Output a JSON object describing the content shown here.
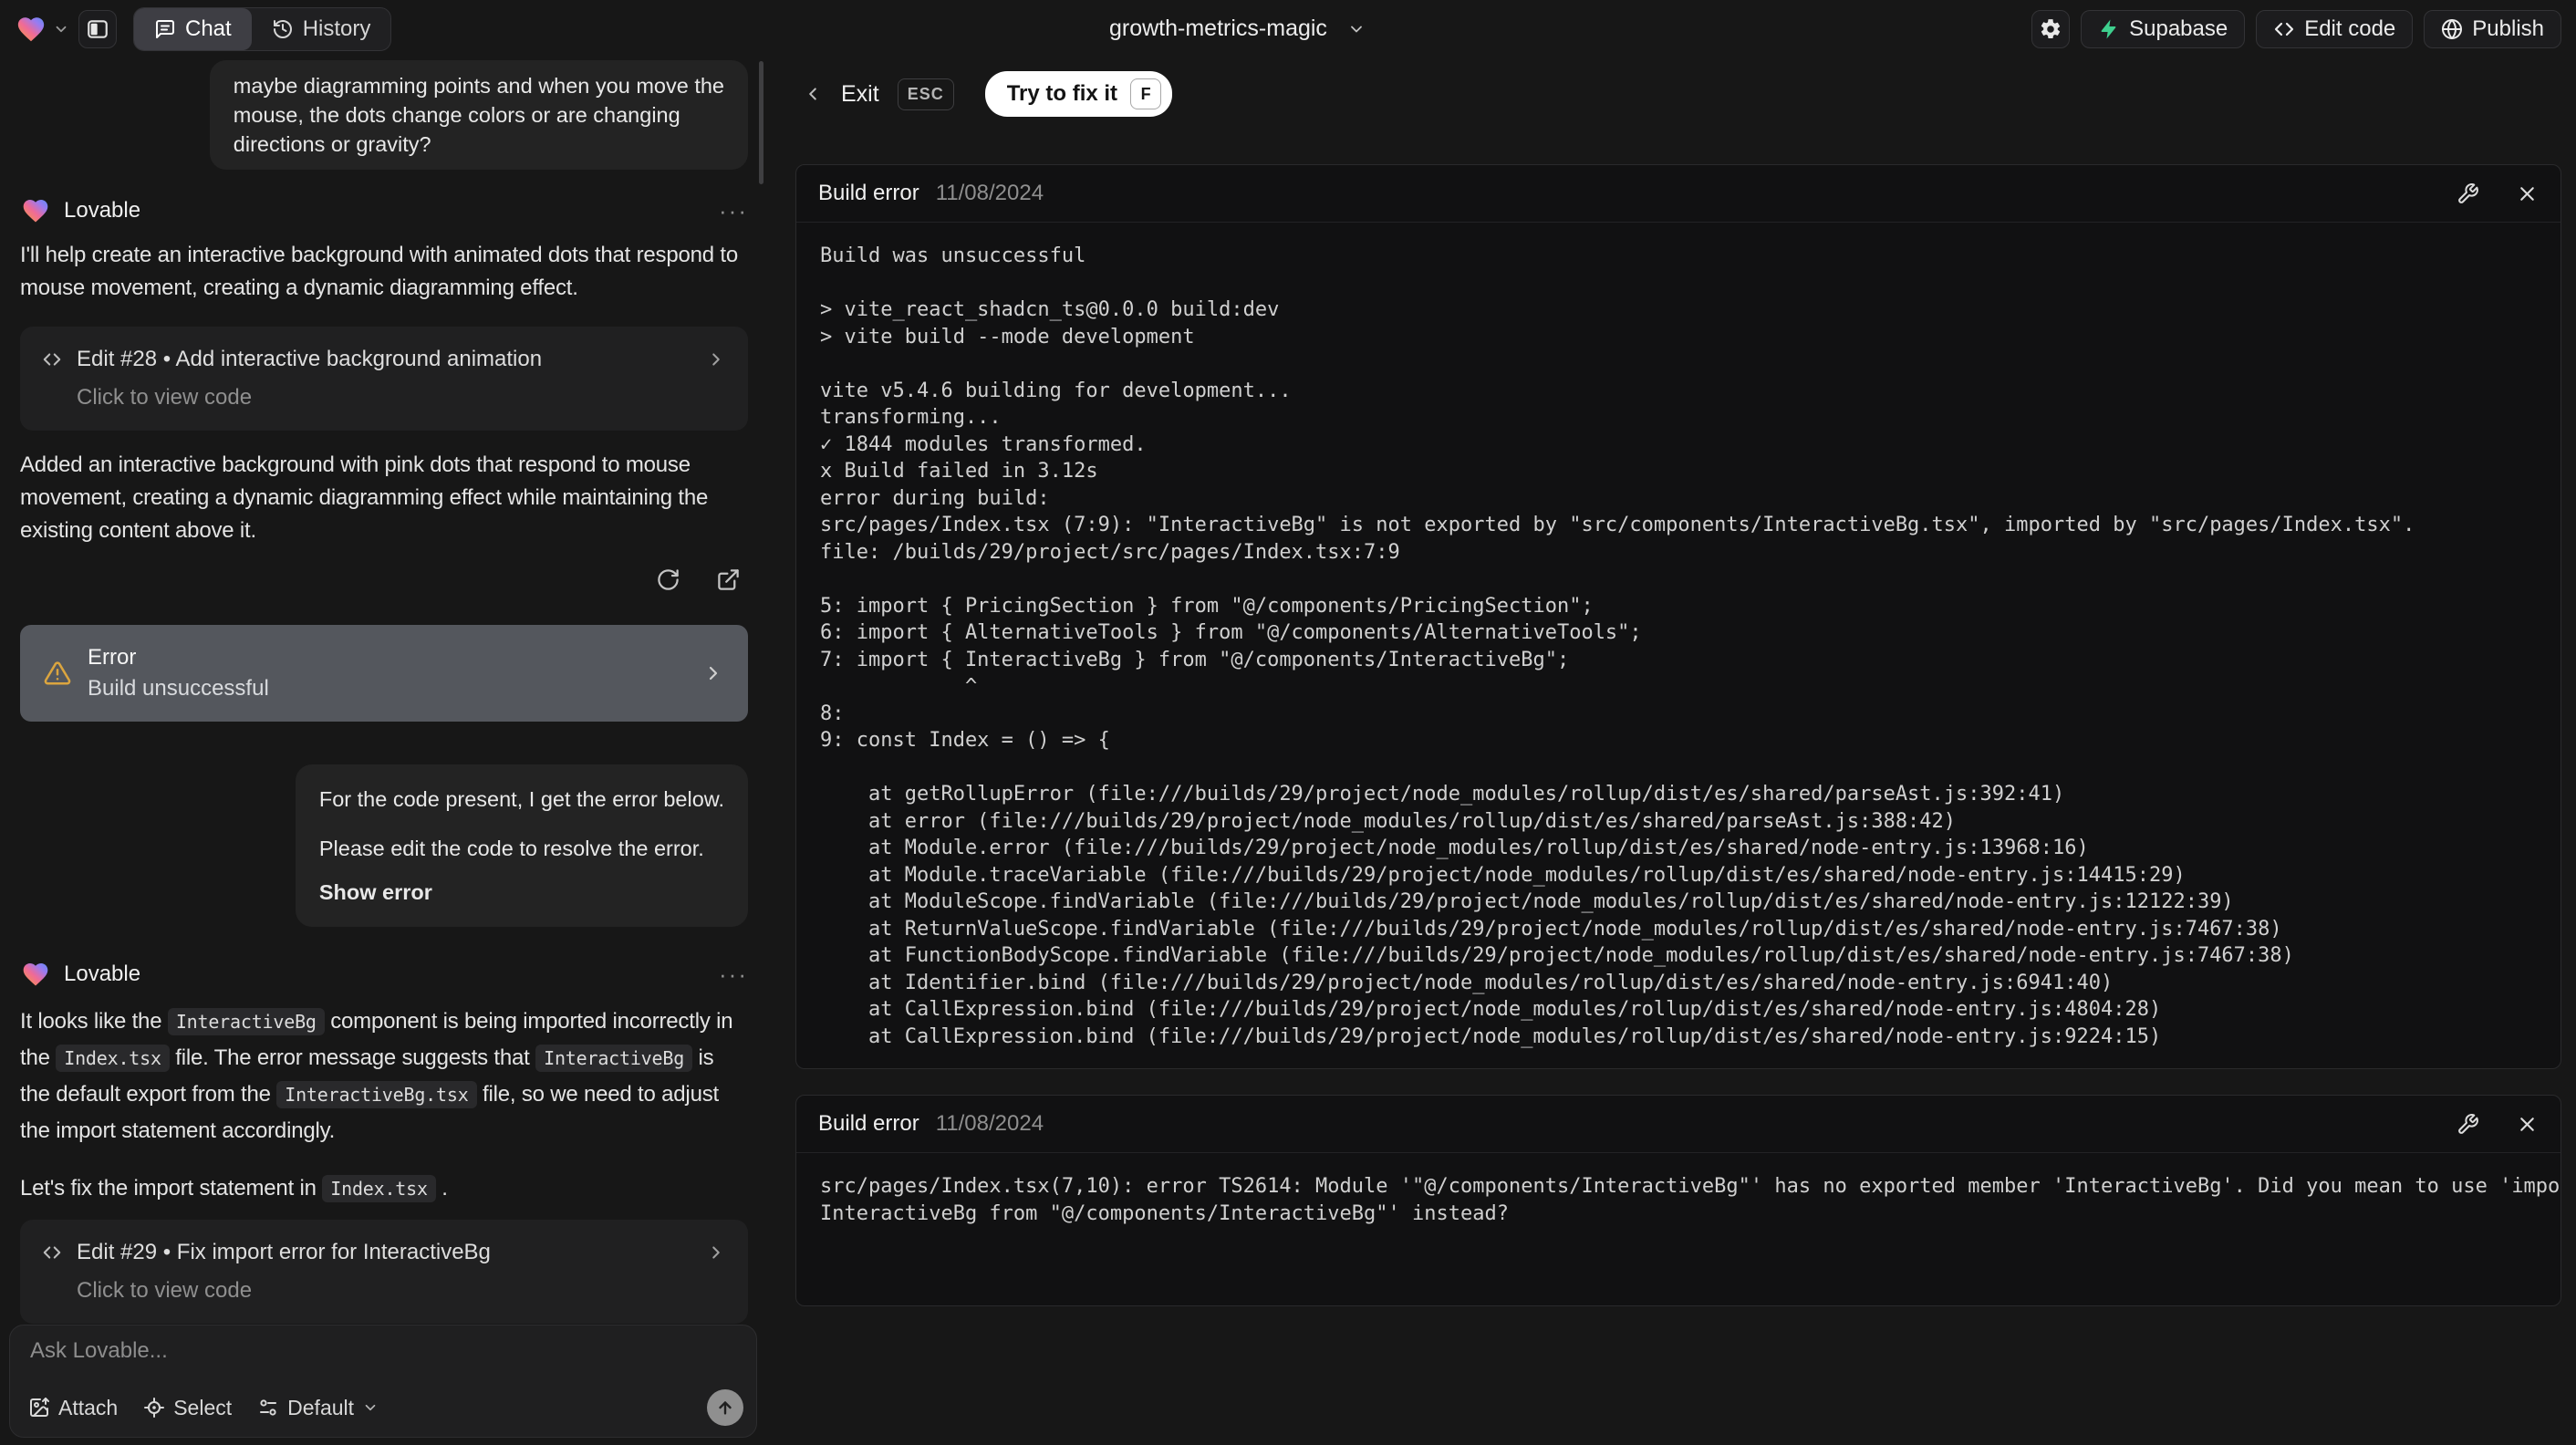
{
  "colors": {
    "supabase_green": "#3ECF8E",
    "warning_amber": "#DBA53F",
    "error_card_bg": "#54575D"
  },
  "topbar": {
    "project_name": "growth-metrics-magic",
    "tabs": {
      "chat": "Chat",
      "history": "History"
    },
    "actions": {
      "supabase": "Supabase",
      "edit_code": "Edit code",
      "publish": "Publish"
    }
  },
  "chat": {
    "user_message_top": {
      "text": "maybe diagramming points and when you move the\nmouse, the dots change colors or are changing\ndirections or gravity?"
    },
    "assistant_1": {
      "name": "Lovable",
      "menu": "···",
      "intro": "I'll help create an interactive background with animated dots that respond to mouse movement, creating a dynamic diagramming effect.",
      "edit_card": {
        "title": "Edit #28 • Add interactive background animation",
        "subtitle": "Click to view code"
      },
      "summary": "Added an interactive background with pink dots that respond to mouse movement, creating a dynamic diagramming effect while maintaining the existing content above it.",
      "error_card": {
        "title": "Error",
        "subtitle": "Build unsuccessful"
      }
    },
    "user_message_error": {
      "line1": "For the code present, I get the error below.",
      "line2": "Please edit the code to resolve the error.",
      "action": "Show error"
    },
    "assistant_2": {
      "name": "Lovable",
      "menu": "···",
      "p1": {
        "a": "It looks like the ",
        "code1": "InteractiveBg",
        "b": " component is being imported incorrectly in the ",
        "code2": "Index.tsx",
        "c": " file. The error message suggests that ",
        "code3": "InteractiveBg",
        "d": " is the default export from the ",
        "code4": "InteractiveBg.tsx",
        "e": " file, so we need to adjust the import statement accordingly."
      },
      "p2": {
        "a": "Let's fix the import statement in ",
        "code": "Index.tsx",
        "b": " ."
      },
      "edit_card": {
        "title": "Edit #29 • Fix import error for InteractiveBg",
        "subtitle": "Click to view code"
      }
    }
  },
  "composer": {
    "placeholder": "Ask Lovable...",
    "attach": "Attach",
    "select": "Select",
    "mode": "Default"
  },
  "fix_panel": {
    "exit": "Exit",
    "esc": "ESC",
    "try_fix": "Try to fix it",
    "try_fix_key": "F",
    "errors": [
      {
        "title": "Build error",
        "date": "11/08/2024",
        "log": "Build was unsuccessful\n\n> vite_react_shadcn_ts@0.0.0 build:dev\n> vite build --mode development\n\nvite v5.4.6 building for development...\ntransforming...\n✓ 1844 modules transformed.\nx Build failed in 3.12s\nerror during build:\nsrc/pages/Index.tsx (7:9): \"InteractiveBg\" is not exported by \"src/components/InteractiveBg.tsx\", imported by \"src/pages/Index.tsx\".\nfile: /builds/29/project/src/pages/Index.tsx:7:9\n\n5: import { PricingSection } from \"@/components/PricingSection\";\n6: import { AlternativeTools } from \"@/components/AlternativeTools\";\n7: import { InteractiveBg } from \"@/components/InteractiveBg\";\n            ^\n8: \n9: const Index = () => {\n\n    at getRollupError (file:///builds/29/project/node_modules/rollup/dist/es/shared/parseAst.js:392:41)\n    at error (file:///builds/29/project/node_modules/rollup/dist/es/shared/parseAst.js:388:42)\n    at Module.error (file:///builds/29/project/node_modules/rollup/dist/es/shared/node-entry.js:13968:16)\n    at Module.traceVariable (file:///builds/29/project/node_modules/rollup/dist/es/shared/node-entry.js:14415:29)\n    at ModuleScope.findVariable (file:///builds/29/project/node_modules/rollup/dist/es/shared/node-entry.js:12122:39)\n    at ReturnValueScope.findVariable (file:///builds/29/project/node_modules/rollup/dist/es/shared/node-entry.js:7467:38)\n    at FunctionBodyScope.findVariable (file:///builds/29/project/node_modules/rollup/dist/es/shared/node-entry.js:7467:38)\n    at Identifier.bind (file:///builds/29/project/node_modules/rollup/dist/es/shared/node-entry.js:6941:40)\n    at CallExpression.bind (file:///builds/29/project/node_modules/rollup/dist/es/shared/node-entry.js:4804:28)\n    at CallExpression.bind (file:///builds/29/project/node_modules/rollup/dist/es/shared/node-entry.js:9224:15)"
      },
      {
        "title": "Build error",
        "date": "11/08/2024",
        "log": "src/pages/Index.tsx(7,10): error TS2614: Module '\"@/components/InteractiveBg\"' has no exported member 'InteractiveBg'. Did you mean to use 'import\nInteractiveBg from \"@/components/InteractiveBg\"' instead?"
      }
    ]
  }
}
